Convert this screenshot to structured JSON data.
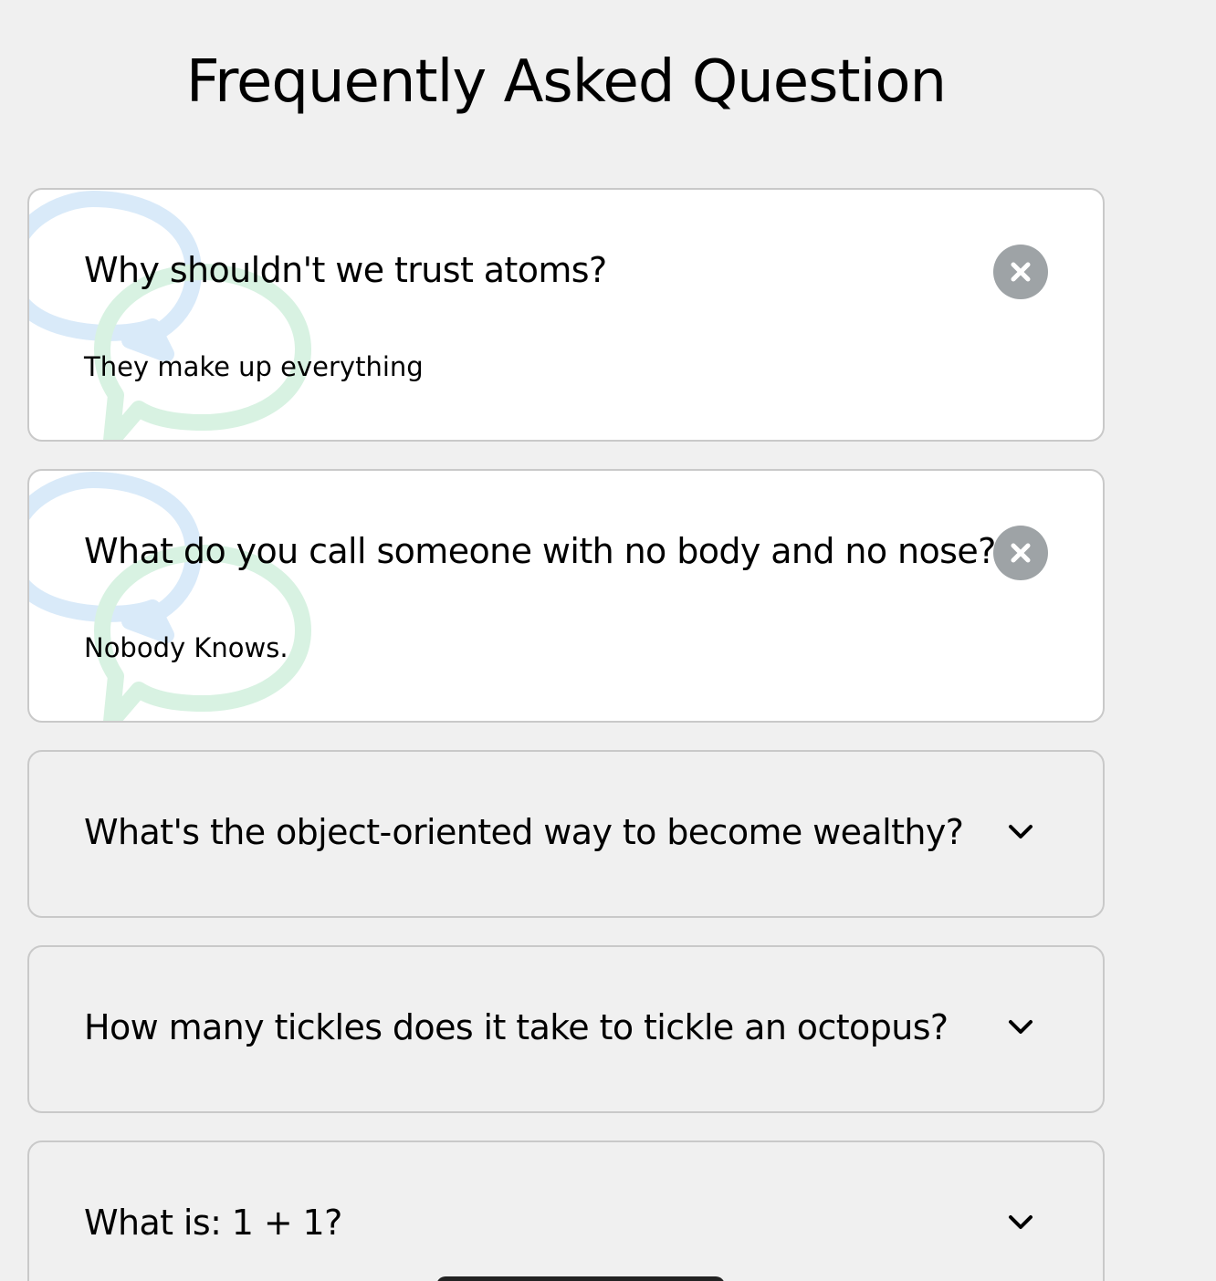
{
  "page": {
    "title": "Frequently Asked Question"
  },
  "faqs": [
    {
      "question": "Why shouldn't we trust atoms?",
      "answer": "They make up everything",
      "expanded": true,
      "toggle_icon": "close-icon"
    },
    {
      "question": "What do you call someone with no body and no nose?",
      "answer": "Nobody Knows.",
      "expanded": true,
      "toggle_icon": "close-icon"
    },
    {
      "question": "What's the object-oriented way to become wealthy?",
      "answer": "",
      "expanded": false,
      "toggle_icon": "chevron-down-icon"
    },
    {
      "question": "How many tickles does it take to tickle an octopus?",
      "answer": "",
      "expanded": false,
      "toggle_icon": "chevron-down-icon"
    },
    {
      "question": "What is: 1 + 1?",
      "answer": "",
      "expanded": false,
      "toggle_icon": "chevron-down-icon"
    }
  ],
  "colors": {
    "background": "#f0f0f0",
    "card_active": "#ffffff",
    "card_border": "#c9c9c9",
    "close_button": "#9ea3a6",
    "bubble_blue": "#d9eaf9",
    "bubble_green": "#d8f2e2"
  }
}
